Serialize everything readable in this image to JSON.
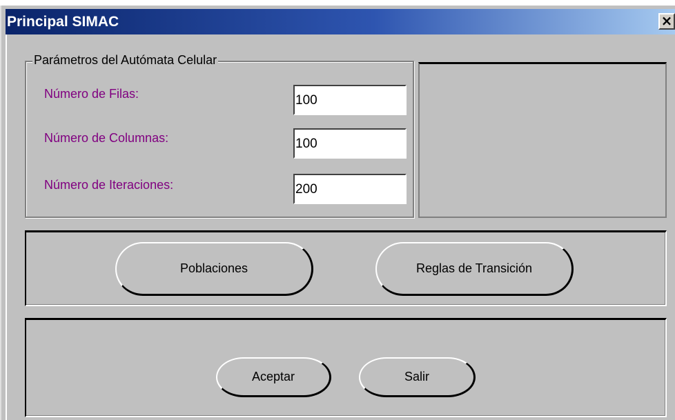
{
  "window": {
    "title": "Principal SIMAC",
    "close_glyph": "×"
  },
  "params": {
    "legend": "Parámetros del Autómata Celular",
    "rows_label": "Número de Filas:",
    "rows_value": "100",
    "cols_label": "Número de Columnas:",
    "cols_value": "100",
    "iter_label": "Número de Iteraciones:",
    "iter_value": "200"
  },
  "actions": {
    "populations_label": "Poblaciones",
    "transition_label": "Reglas de Transición"
  },
  "footer": {
    "accept_label": "Aceptar",
    "exit_label": "Salir"
  },
  "colors": {
    "title_bar_start": "#0a246a",
    "label_text": "#800080",
    "window_face": "#c0c0c0"
  }
}
